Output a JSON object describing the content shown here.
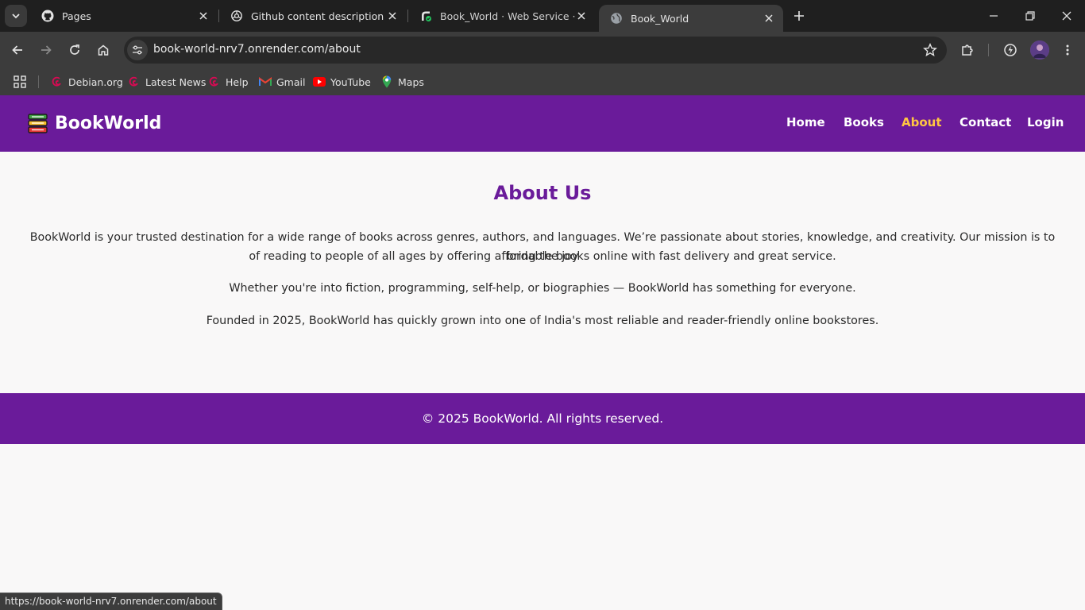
{
  "browser": {
    "tabs": [
      {
        "title": "Pages",
        "icon": "github-icon"
      },
      {
        "title": "Github content description",
        "icon": "chatgpt-icon"
      },
      {
        "title": "Book_World · Web Service · Re",
        "icon": "render-icon"
      },
      {
        "title": "Book_World",
        "icon": "globe-icon"
      }
    ],
    "address": "book-world-nrv7.onrender.com/about",
    "bookmarks": [
      {
        "label": "Debian.org",
        "icon": "debian-icon",
        "color": "#d70a53"
      },
      {
        "label": "Latest News",
        "icon": "debian-icon",
        "color": "#d70a53"
      },
      {
        "label": "Help",
        "icon": "debian-icon",
        "color": "#d70a53"
      },
      {
        "label": "Gmail",
        "icon": "gmail-icon",
        "color": "#ea4335"
      },
      {
        "label": "YouTube",
        "icon": "youtube-icon",
        "color": "#ff0000"
      },
      {
        "label": "Maps",
        "icon": "maps-icon",
        "color": "#34a853"
      }
    ],
    "status_url": "https://book-world-nrv7.onrender.com/about"
  },
  "site": {
    "brand": "BookWorld",
    "nav": [
      "Home",
      "Books",
      "About",
      "Contact",
      "Login"
    ],
    "active_nav": "About",
    "colors": {
      "primary": "#6a1b9a",
      "accent": "#ffc542",
      "background": "#f9f8f8"
    }
  },
  "about": {
    "title": "About Us",
    "paragraph1_line1": "BookWorld is your trusted destination for a wide range of books across genres, authors, and languages. We’re passionate about stories, knowledge, and creativity. Our mission is to bring the joy",
    "paragraph1_line2": "of reading to people of all ages by offering affordable books online with fast delivery and great service.",
    "paragraph2": "Whether you're into fiction, programming, self-help, or biographies — BookWorld has something for everyone.",
    "paragraph3": "Founded in 2025, BookWorld has quickly grown into one of India's most reliable and reader-friendly online bookstores."
  },
  "footer": {
    "text": "© 2025 BookWorld. All rights reserved."
  }
}
